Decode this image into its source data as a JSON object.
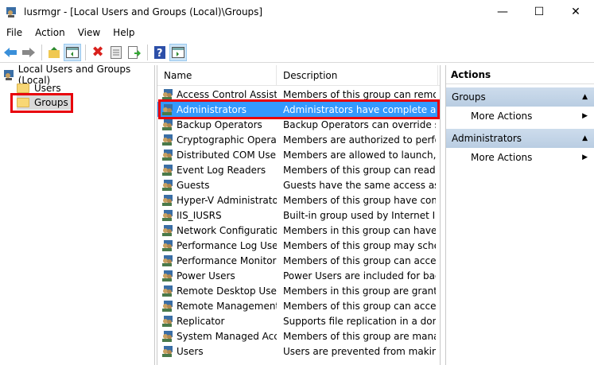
{
  "window": {
    "title": "lusrmgr - [Local Users and Groups (Local)\\Groups]",
    "minimize": "—",
    "maximize": "☐",
    "close": "✕"
  },
  "menu": [
    "File",
    "Action",
    "View",
    "Help"
  ],
  "tree": {
    "root": "Local Users and Groups (Local)",
    "items": [
      "Users",
      "Groups"
    ]
  },
  "list": {
    "headers": [
      "Name",
      "Description"
    ],
    "rows": [
      {
        "name": "Access Control Assist...",
        "desc": "Members of this group can remot..."
      },
      {
        "name": "Administrators",
        "desc": "Administrators have complete an..."
      },
      {
        "name": "Backup Operators",
        "desc": "Backup Operators can override se..."
      },
      {
        "name": "Cryptographic Operat...",
        "desc": "Members are authorized to perfor..."
      },
      {
        "name": "Distributed COM Users",
        "desc": "Members are allowed to launch, a..."
      },
      {
        "name": "Event Log Readers",
        "desc": "Members of this group can read e..."
      },
      {
        "name": "Guests",
        "desc": "Guests have the same access as m..."
      },
      {
        "name": "Hyper-V Administrators",
        "desc": "Members of this group have com..."
      },
      {
        "name": "IIS_IUSRS",
        "desc": "Built-in group used by Internet Inf..."
      },
      {
        "name": "Network Configuratio...",
        "desc": "Members in this group can have s..."
      },
      {
        "name": "Performance Log Users",
        "desc": "Members of this group may sche..."
      },
      {
        "name": "Performance Monitor ...",
        "desc": "Members of this group can acces..."
      },
      {
        "name": "Power Users",
        "desc": "Power Users are included for back..."
      },
      {
        "name": "Remote Desktop Users",
        "desc": "Members in this group are grante..."
      },
      {
        "name": "Remote Management...",
        "desc": "Members of this group can acces..."
      },
      {
        "name": "Replicator",
        "desc": "Supports file replication in a dom..."
      },
      {
        "name": "System Managed Acc...",
        "desc": "Members of this group are mana..."
      },
      {
        "name": "Users",
        "desc": "Users are prevented from making ..."
      }
    ]
  },
  "actions": {
    "title": "Actions",
    "sections": [
      {
        "title": "Groups",
        "item": "More Actions"
      },
      {
        "title": "Administrators",
        "item": "More Actions"
      }
    ]
  },
  "colors": {
    "selection": "#3399ff",
    "highlight": "#e8000b"
  }
}
